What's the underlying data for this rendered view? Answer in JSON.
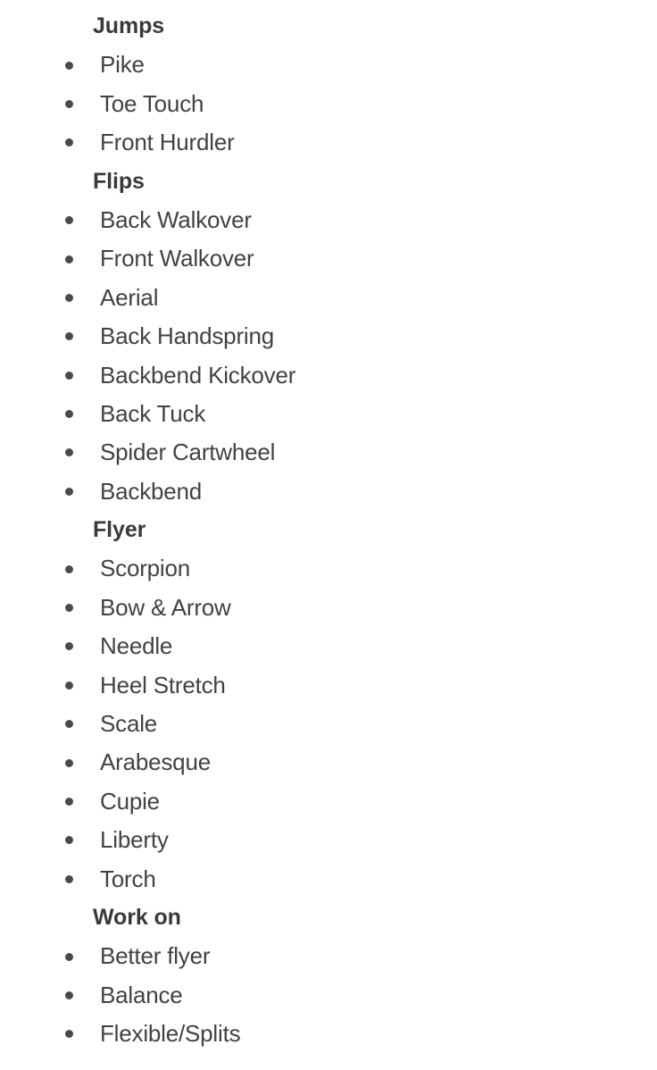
{
  "document": {
    "type": "bulleted-outline-note",
    "background_color": "#ffffff",
    "text_color": "#424242",
    "heading_color": "#3a3a3a",
    "bullet_color": "#4a4a4a"
  },
  "outline": [
    {
      "kind": "heading",
      "text": "Jumps"
    },
    {
      "kind": "item",
      "text": "Pike"
    },
    {
      "kind": "item",
      "text": "Toe Touch"
    },
    {
      "kind": "item",
      "text": "Front Hurdler"
    },
    {
      "kind": "heading",
      "text": "Flips"
    },
    {
      "kind": "item",
      "text": "Back Walkover"
    },
    {
      "kind": "item",
      "text": "Front Walkover"
    },
    {
      "kind": "item",
      "text": "Aerial"
    },
    {
      "kind": "item",
      "text": "Back Handspring"
    },
    {
      "kind": "item",
      "text": "Backbend Kickover"
    },
    {
      "kind": "item",
      "text": "Back Tuck"
    },
    {
      "kind": "item",
      "text": "Spider Cartwheel"
    },
    {
      "kind": "item",
      "text": "Backbend"
    },
    {
      "kind": "heading",
      "text": "Flyer"
    },
    {
      "kind": "item",
      "text": "Scorpion"
    },
    {
      "kind": "item",
      "text": "Bow & Arrow"
    },
    {
      "kind": "item",
      "text": "Needle"
    },
    {
      "kind": "item",
      "text": "Heel Stretch"
    },
    {
      "kind": "item",
      "text": "Scale"
    },
    {
      "kind": "item",
      "text": "Arabesque"
    },
    {
      "kind": "item",
      "text": "Cupie"
    },
    {
      "kind": "item",
      "text": "Liberty"
    },
    {
      "kind": "item",
      "text": "Torch"
    },
    {
      "kind": "heading",
      "text": "Work on"
    },
    {
      "kind": "item",
      "text": "Better flyer"
    },
    {
      "kind": "item",
      "text": "Balance"
    },
    {
      "kind": "item",
      "text": "Flexible/Splits"
    }
  ]
}
